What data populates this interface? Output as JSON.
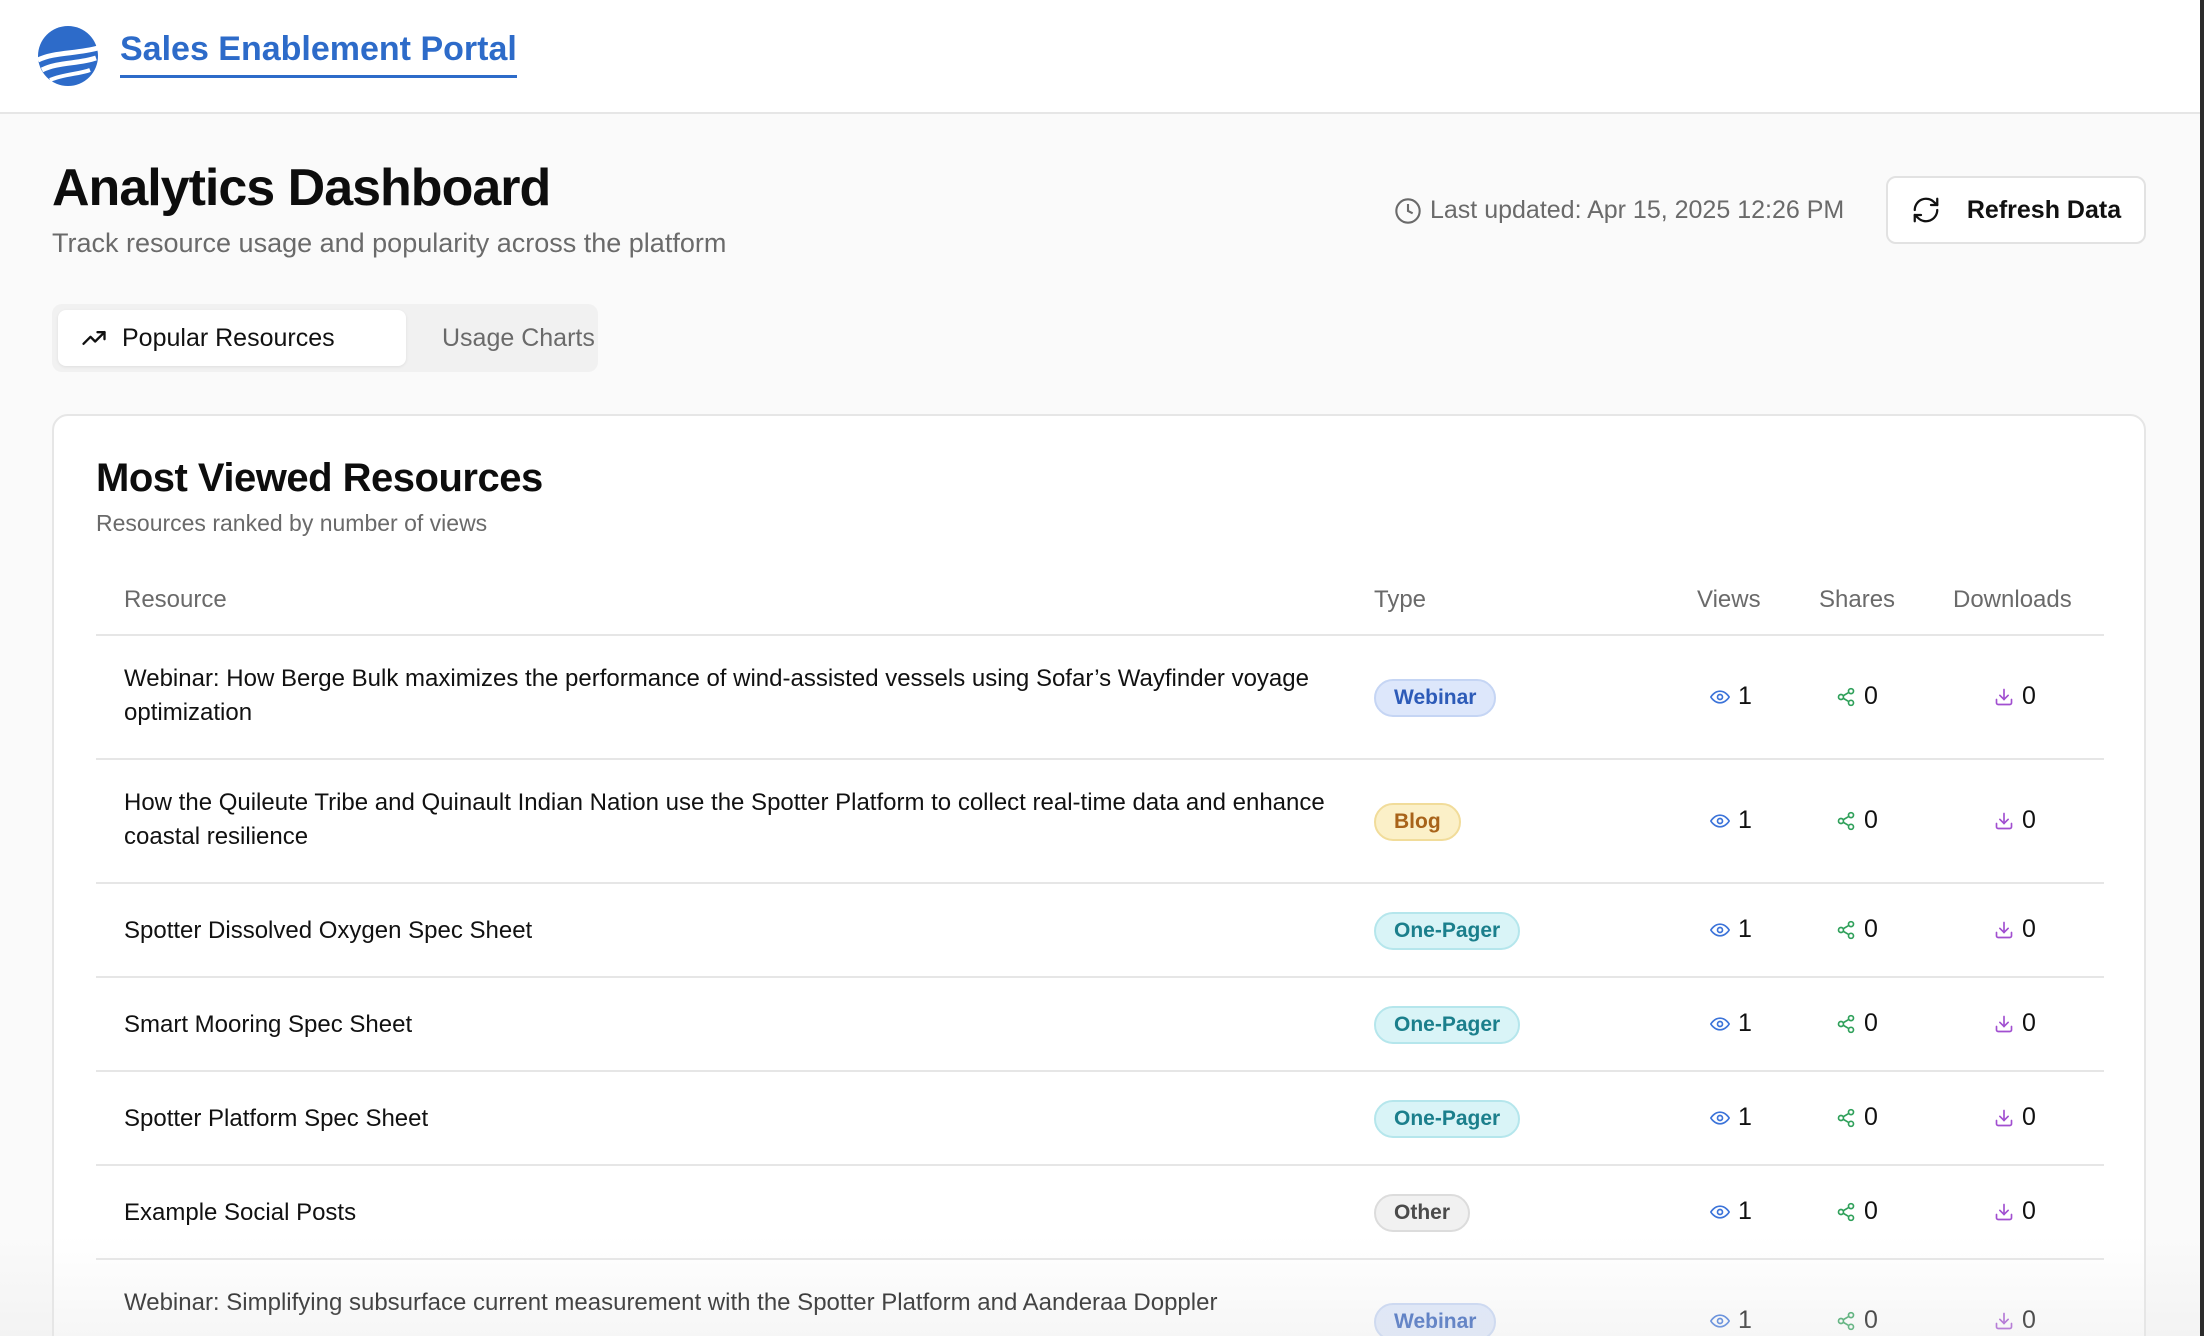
{
  "app": {
    "brand": "Sales Enablement Portal"
  },
  "header": {
    "title": "Analytics Dashboard",
    "subtitle": "Track resource usage and popularity across the platform",
    "last_updated": "Last updated: Apr 15, 2025 12:26 PM",
    "refresh_label": "Refresh Data"
  },
  "tabs": [
    {
      "label": "Popular Resources",
      "active": true,
      "icon": "trending-up-icon"
    },
    {
      "label": "Usage Charts",
      "active": false,
      "icon": "bar-chart-icon"
    }
  ],
  "card": {
    "title": "Most Viewed Resources",
    "subtitle": "Resources ranked by number of views"
  },
  "table": {
    "columns": [
      "Resource",
      "Type",
      "Views",
      "Shares",
      "Downloads"
    ],
    "rows": [
      {
        "resource": "Webinar: How Berge Bulk maximizes the performance of wind-assisted vessels using Sofar’s Wayfinder voyage optimization",
        "type": "Webinar",
        "views": "1",
        "shares": "0",
        "downloads": "0"
      },
      {
        "resource": "How the Quileute Tribe and Quinault Indian Nation use the Spotter Platform to collect real-time data and enhance coastal resilience",
        "type": "Blog",
        "views": "1",
        "shares": "0",
        "downloads": "0"
      },
      {
        "resource": "Spotter Dissolved Oxygen Spec Sheet",
        "type": "One-Pager",
        "views": "1",
        "shares": "0",
        "downloads": "0"
      },
      {
        "resource": "Smart Mooring Spec Sheet",
        "type": "One-Pager",
        "views": "1",
        "shares": "0",
        "downloads": "0"
      },
      {
        "resource": "Spotter Platform Spec Sheet",
        "type": "One-Pager",
        "views": "1",
        "shares": "0",
        "downloads": "0"
      },
      {
        "resource": "Example Social Posts",
        "type": "Other",
        "views": "1",
        "shares": "0",
        "downloads": "0"
      },
      {
        "resource": "Webinar: Simplifying subsurface current measurement with the Spotter Platform and Aanderaa Doppler",
        "type": "Webinar",
        "views": "1",
        "shares": "0",
        "downloads": "0"
      }
    ]
  },
  "badge_colors": {
    "Webinar": {
      "bg": "#dde7fb",
      "fg": "#2d5bb8",
      "border": "#c5d5f4"
    },
    "Blog": {
      "bg": "#fbf0c8",
      "fg": "#a8631a",
      "border": "#f1dc9a"
    },
    "One-Pager": {
      "bg": "#d9f4f7",
      "fg": "#1b7f8c",
      "border": "#b5e6ec"
    },
    "Other": {
      "bg": "#f1f1f1",
      "fg": "#4b4b4b",
      "border": "#dcdcdc"
    }
  },
  "stat_colors": {
    "views": "#3b73d9",
    "shares": "#2fa05a",
    "downloads": "#a14fd0"
  }
}
